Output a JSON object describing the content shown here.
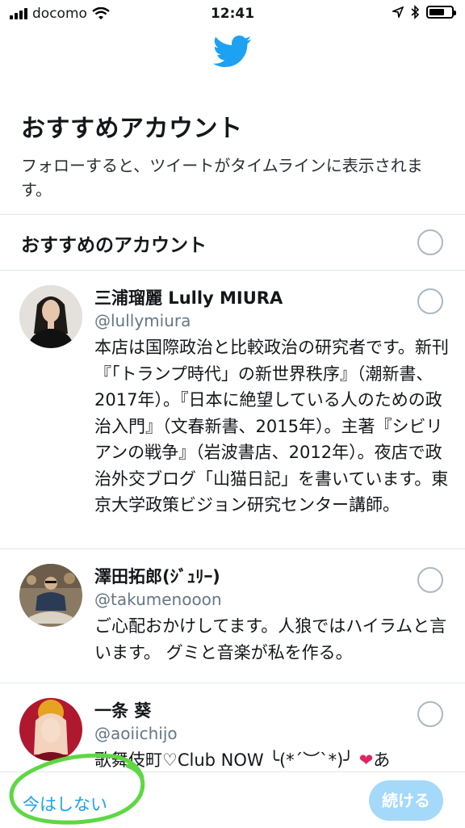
{
  "status_bar": {
    "carrier": "docomo",
    "time": "12:41",
    "wifi_icon": "wifi-icon",
    "location_icon": "location-arrow-icon",
    "bluetooth_icon": "bluetooth-icon",
    "battery_icon": "battery-icon"
  },
  "header": {
    "logo_icon": "twitter-bird-icon",
    "title": "おすすめアカウント",
    "subtitle": "フォローすると、ツイートがタイムラインに表示されます。"
  },
  "section": {
    "label": "おすすめのアカウント"
  },
  "accounts": [
    {
      "name": "三浦瑠麗 Lully MIURA",
      "handle": "@lullymiura",
      "bio": "本店は国際政治と比較政治の研究者です。新刊『「トランプ時代」の新世界秩序』（潮新書、2017年）。『日本に絶望している人のための政治入門』（文春新書、2015年）。主著『シビリアンの戦争』（岩波書店、2012年）。夜店で政治外交ブログ「山猫日記」を書いています。東京大学政策ビジョン研究センター講師。"
    },
    {
      "name": "澤田拓郎(ｼﾞｭﾘｰ)",
      "handle": "@takumenooon",
      "bio": "ご心配おかけしてます。人狼ではハイラムと言います。 グミと音楽が私を作る。"
    },
    {
      "name": "一条 葵",
      "handle": "@aoiichijo",
      "bio": "歌舞伎町♡Club NOW ╰(*´︶`*)╯",
      "bio_tail": "あ"
    }
  ],
  "footer": {
    "skip_label": "今はしない",
    "continue_label": "続ける"
  },
  "colors": {
    "accent": "#1da1f2",
    "accent_disabled": "#a5d9fa",
    "annotation": "#5dd843",
    "heart": "#e0245e"
  }
}
